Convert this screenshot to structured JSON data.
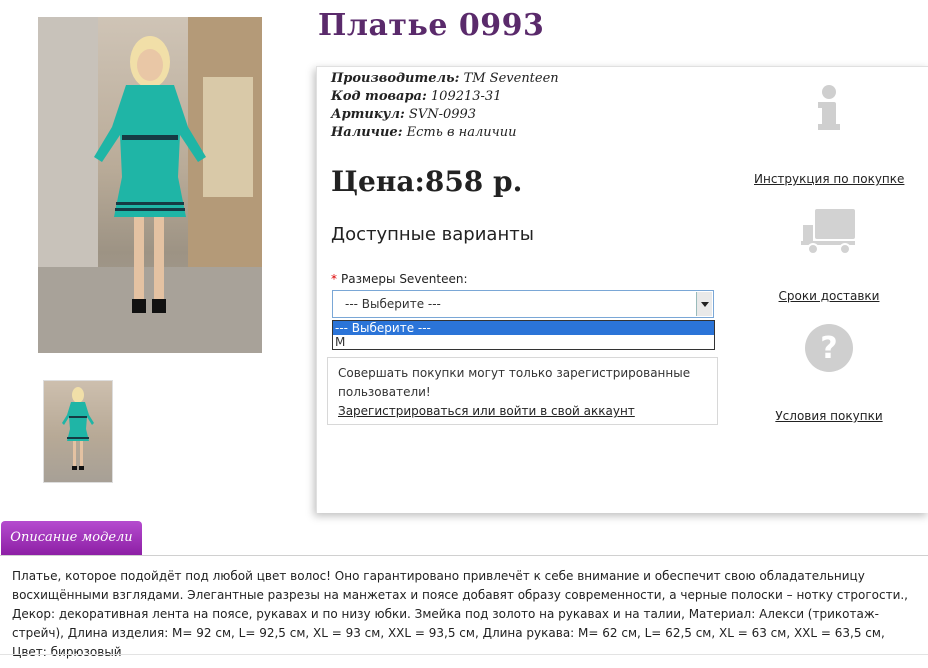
{
  "product": {
    "title": "Платье 0993",
    "manufacturer_label": "Производитель:",
    "manufacturer_value": "ТМ Seventeen",
    "code_label": "Код товара:",
    "code_value": "109213-31",
    "article_label": "Артикул:",
    "article_value": "SVN-0993",
    "availability_label": "Наличие:",
    "availability_value": "Есть в наличии",
    "price": "Цена:858 р."
  },
  "variants": {
    "heading": "Доступные варианты",
    "required_mark": "*",
    "size_label": "Размеры Seventeen:",
    "select_value": "--- Выберите ---",
    "options": [
      "--- Выберите ---",
      "M"
    ]
  },
  "login_notice": {
    "text": "Совершать покупки могут только зарегистрированные пользователи!",
    "link": "Зарегистрироваться или войти в свой аккаунт"
  },
  "sidebar": {
    "instructions_link": "Инструкция по покупке",
    "delivery_link": "Сроки доставки",
    "terms_link": "Условия покупки",
    "icons": [
      "info-icon",
      "truck-icon",
      "question-icon"
    ]
  },
  "description": {
    "tab_label": "Описание модели",
    "text": "Платье, которое подойдёт под любой цвет волос! Оно гарантировано привлечёт к себе внимание и обеспечит свою обладательницу восхищёнными взглядами. Элегантные разрезы на манжетах и поясе добавят образу современности, а черные полоски – нотку строгости., Декор: декоративная лента на поясе, рукавах и по низу юбки. Змейка под золото на рукавах и на талии, Материал: Алекси (трикотаж-стрейч), Длина изделия: M= 92 см, L= 92,5 см, XL = 93 см, XXL = 93,5 см, Длина рукава: M= 62 см, L= 62,5 см, XL = 63 см, XXL = 63,5 см, Цвет: бирюзовый"
  },
  "colors": {
    "title": "#5a2a6b",
    "tab": "#9b2bb5",
    "dress": "#1fb5a6",
    "select_highlight": "#2b74d8"
  }
}
